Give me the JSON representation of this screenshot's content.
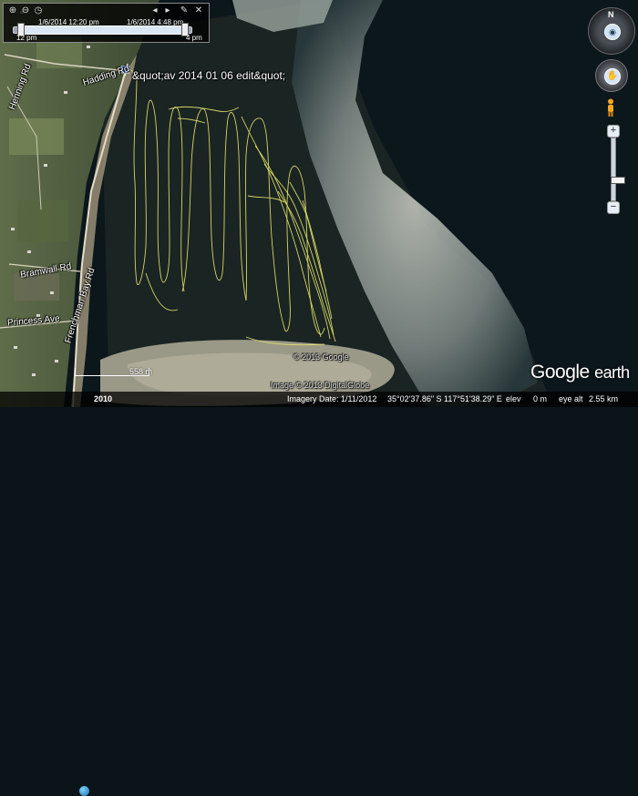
{
  "app": {
    "title": "Google Earth"
  },
  "track": {
    "title": "&quot;av 2014 01 06 edit&quot;",
    "color": "#e8e86a"
  },
  "timeslider": {
    "start_date": "1/6/2014  12:20 pm",
    "end_date": "1/6/2014  4:48 pm",
    "start_label": "12 pm",
    "end_label": "4 pm",
    "icons": [
      "zoom-in-icon",
      "zoom-out-icon",
      "clock-icon",
      "play-prev-icon",
      "play-next-icon",
      "wrench-icon",
      "close-icon"
    ]
  },
  "roads": {
    "hadding": "Hadding Rd",
    "henning": "Henning Rd",
    "bramwall": "Bramwall Rd",
    "frenchman_bay": "Frenchman Bay Rd",
    "princess": "Princess Ave"
  },
  "copyrights": {
    "google": "© 2013 Google",
    "digitalglobe": "Image © 2013 DigitalGlobe"
  },
  "scale": {
    "label": "558 m"
  },
  "statusbar": {
    "year": "2010",
    "imagery_date": "Imagery Date: 1/11/2012",
    "latitude": "35°02'37.86\" S",
    "longitude": "117°51'38.29\" E",
    "elev_label": "elev",
    "elev_value": "0 m",
    "eye_alt_label": "eye alt",
    "eye_alt_value": "2.55 km"
  },
  "logo": {
    "google": "Google",
    "earth": "earth"
  },
  "compass": {
    "north": "N"
  },
  "zoom": {
    "plus": "+",
    "minus": "−"
  }
}
